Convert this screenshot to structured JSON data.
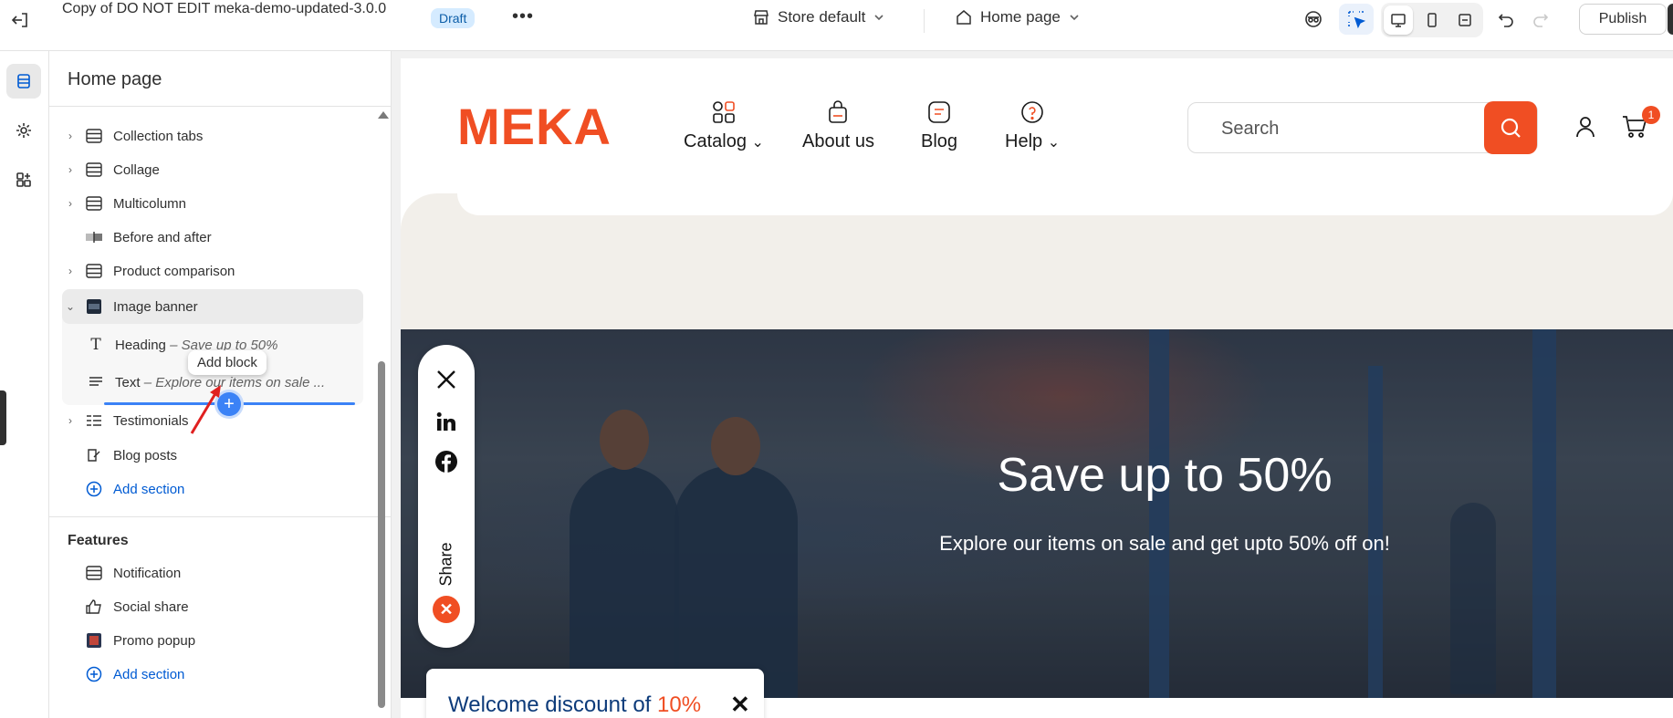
{
  "topbar": {
    "title": "Copy of DO NOT EDIT meka-demo-updated-3.0.0",
    "status": "Draft",
    "more": "•••",
    "store_selector": "Store default",
    "page_selector": "Home page",
    "publish": "Publish"
  },
  "sidebar": {
    "title": "Home page",
    "sections": [
      {
        "label": "Collection tabs"
      },
      {
        "label": "Collage"
      },
      {
        "label": "Multicolumn"
      },
      {
        "label": "Before and after"
      },
      {
        "label": "Product comparison"
      },
      {
        "label": "Image banner"
      },
      {
        "label": "Testimonials"
      },
      {
        "label": "Blog posts"
      }
    ],
    "blocks": [
      {
        "type": "Heading",
        "detail": "– Save up to 50%"
      },
      {
        "type": "Text",
        "detail": "– Explore our items on sale ..."
      }
    ],
    "add_section": "Add section",
    "features_title": "Features",
    "features": [
      {
        "label": "Notification"
      },
      {
        "label": "Social share"
      },
      {
        "label": "Promo popup"
      }
    ],
    "add_section_features": "Add section",
    "tooltip": "Add block",
    "insert_button": "+"
  },
  "preview": {
    "logo": "MEKA",
    "nav": [
      {
        "label": "Catalog",
        "icon": "grid-icon",
        "dropdown": true
      },
      {
        "label": "About us",
        "icon": "bag-icon",
        "dropdown": false
      },
      {
        "label": "Blog",
        "icon": "blog-icon",
        "dropdown": false
      },
      {
        "label": "Help",
        "icon": "help-icon",
        "dropdown": true
      }
    ],
    "search_placeholder": "Search",
    "cart_count": "1",
    "banner": {
      "heading": "Save up to 50%",
      "text": "Explore our items on sale and get upto 50% off on!"
    },
    "share": {
      "label": "Share",
      "networks": [
        "x-icon",
        "linkedin-icon",
        "facebook-icon"
      ]
    },
    "welcome": {
      "text": "Welcome discount of",
      "percent": "10%"
    }
  },
  "colors": {
    "brand": "#f04e23",
    "accent_blue": "#005bd3",
    "draft_bg": "#d5ebff"
  }
}
